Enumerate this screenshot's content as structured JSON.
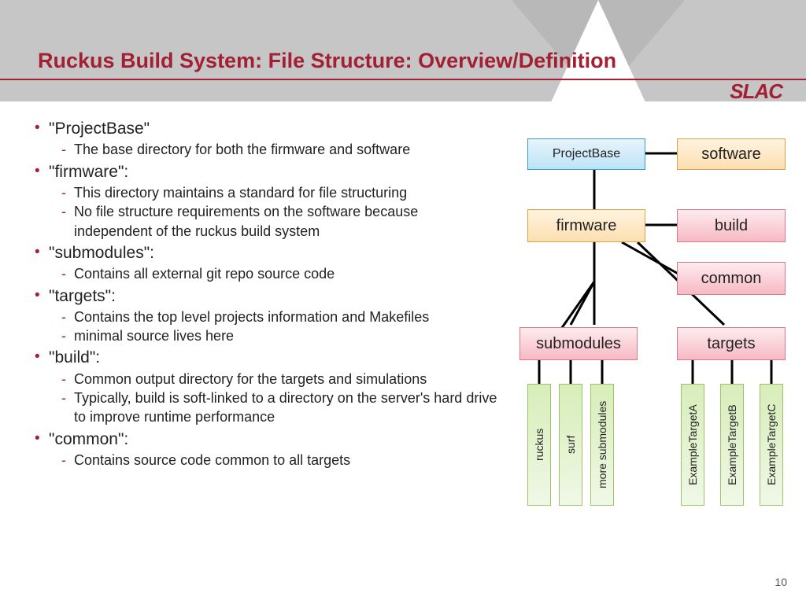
{
  "slide": {
    "title": "Ruckus Build System: File Structure: Overview/Definition",
    "logo": "SLAC",
    "page": "10"
  },
  "bullets": [
    {
      "term": "\"ProjectBase\"",
      "subs": [
        "The base directory for both the firmware and software"
      ]
    },
    {
      "term": "\"firmware\":",
      "subs": [
        "This directory maintains a standard for file structuring",
        "No file structure requirements on the software because independent of the ruckus build system"
      ]
    },
    {
      "term": "\"submodules\":",
      "subs": [
        "Contains all external git repo source code"
      ]
    },
    {
      "term": "\"targets\":",
      "subs": [
        "Contains the top level projects information and Makefiles",
        "minimal source lives here"
      ]
    },
    {
      "term": "\"build\":",
      "subs": [
        "Common output directory for the targets and simulations",
        "Typically, build is soft-linked to a directory on the server's hard drive to improve runtime performance"
      ]
    },
    {
      "term": "\"common\":",
      "subs": [
        "Contains source code common to all targets"
      ]
    }
  ],
  "diagram": {
    "projectbase": "ProjectBase",
    "software": "software",
    "firmware": "firmware",
    "build": "build",
    "common": "common",
    "submodules": "submodules",
    "targets": "targets",
    "ruckus": "ruckus",
    "surf": "surf",
    "more": "more submodules",
    "exA": "ExampleTargetA",
    "exB": "ExampleTargetB",
    "exC": "ExampleTargetC"
  }
}
